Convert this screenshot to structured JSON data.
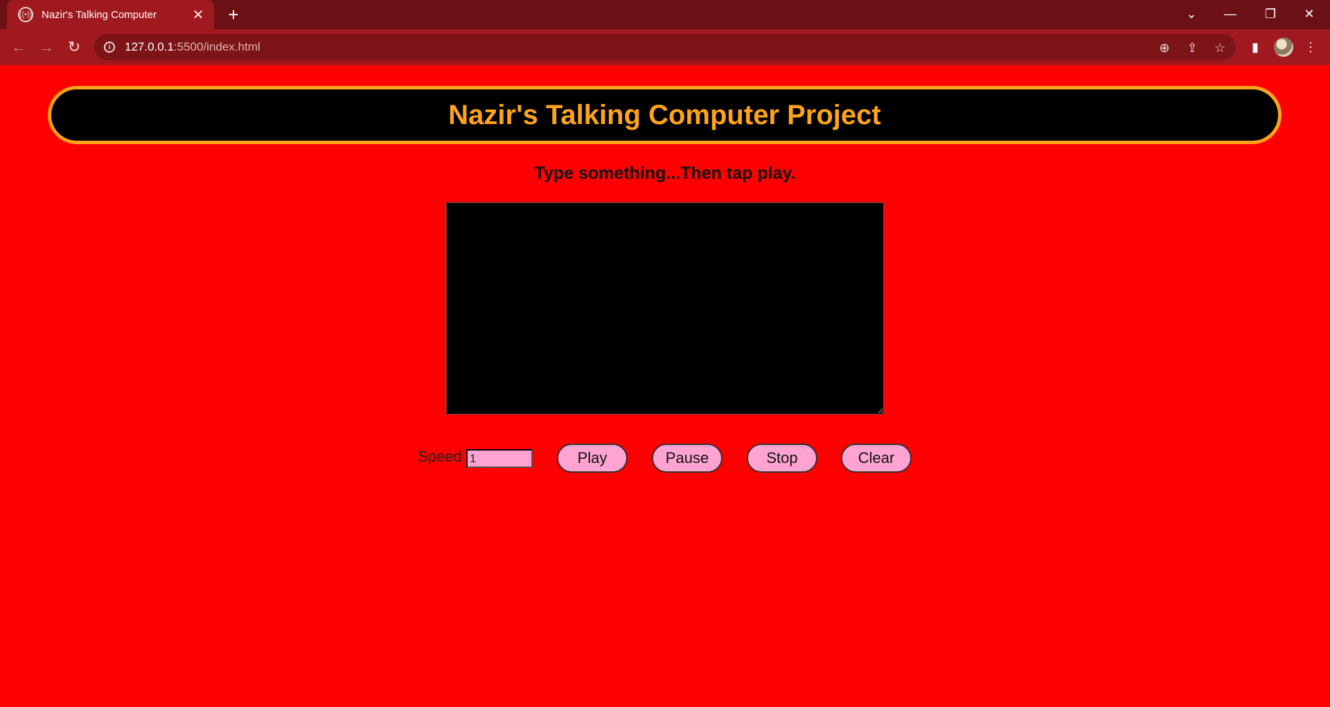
{
  "browser": {
    "tab_title": "Nazir's Talking Computer",
    "new_tab_symbol": "+",
    "url_host": "127.0.0.1",
    "url_path": ":5500/index.html",
    "icons": [
      "back-arrow-icon",
      "forward-arrow-icon",
      "reload-icon",
      "site-info-icon",
      "zoom-icon",
      "share-icon",
      "bookmark-star-icon",
      "side-panel-icon",
      "profile-avatar",
      "menu-kebab-icon",
      "tab-search-icon",
      "minimize-icon",
      "restore-icon",
      "close-window-icon"
    ]
  },
  "page": {
    "title": "Nazir's Talking Computer Project",
    "instruction": "Type something...Then tap play.",
    "textarea_value": "",
    "speed_label": "Speed",
    "speed_value": "1",
    "buttons": {
      "play": "Play",
      "pause": "Pause",
      "stop": "Stop",
      "clear": "Clear"
    }
  },
  "colors": {
    "page_background": "#ff0000",
    "banner_background": "#000000",
    "banner_accent": "#ffa31a",
    "button_fill": "#ffa4d2",
    "browser_frame": "#6b1014",
    "browser_toolbar": "#a0191e"
  }
}
